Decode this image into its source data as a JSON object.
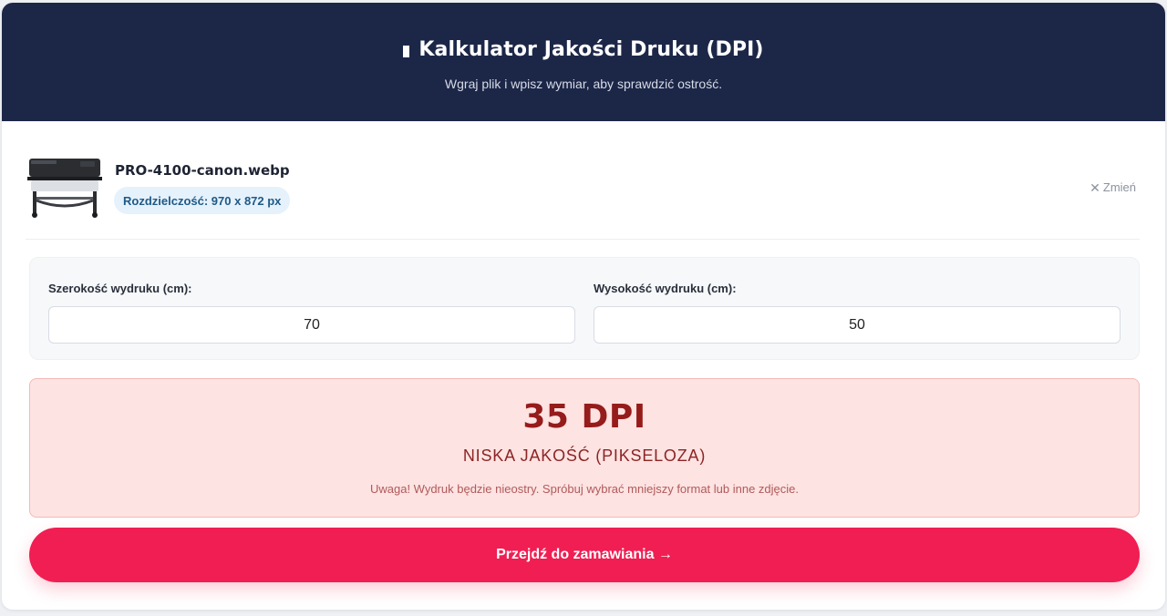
{
  "header": {
    "title": "Kalkulator Jakości Druku (DPI)",
    "subtitle": "Wgraj plik i wpisz wymiar, aby sprawdzić ostrość."
  },
  "file": {
    "name": "PRO-4100-canon.webp",
    "resolution_label": "Rozdzielczość: 970 x 872 px",
    "change_label": "Zmień"
  },
  "dimensions": {
    "width_label": "Szerokość wydruku (cm):",
    "width_value": "70",
    "height_label": "Wysokość wydruku (cm):",
    "height_value": "50"
  },
  "result": {
    "dpi": "35 DPI",
    "quality": "NISKA JAKOŚĆ (PIKSELOZA)",
    "warning": "Uwaga! Wydruk będzie nieostry. Spróbuj wybrać mniejszy format lub inne zdjęcie."
  },
  "cta": {
    "label": "Przejdź do zamawiania →"
  },
  "colors": {
    "header_bg": "#1c2748",
    "result_bg": "#fde3e2",
    "dpi_text": "#961b1b",
    "cta_bg": "#f01e52",
    "badge_bg": "#e5f1fb"
  }
}
